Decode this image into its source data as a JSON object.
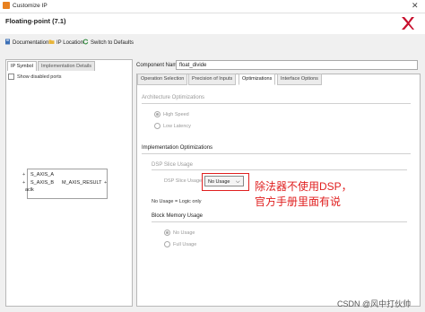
{
  "window": {
    "title": "Customize IP"
  },
  "header": {
    "title": "Floating-point (7.1)"
  },
  "toolbar": {
    "documentation": "Documentation",
    "ip_location": "IP Location",
    "switch_defaults": "Switch to Defaults"
  },
  "left_tabs": {
    "ip_symbol": "IP Symbol",
    "impl_details": "Implementation Details"
  },
  "left_panel": {
    "show_disabled": "Show disabled ports",
    "ports": {
      "s_axis_a": "S_AXIS_A",
      "s_axis_b": "S_AXIS_B",
      "aclk": "aclk",
      "m_axis_result": "M_AXIS_RESULT"
    }
  },
  "component": {
    "label": "Component Name",
    "value": "float_divide"
  },
  "right_tabs": [
    "Operation Selection",
    "Precision of Inputs",
    "Optimizations",
    "Interface Options"
  ],
  "arch": {
    "title": "Architecture Optimizations",
    "high_speed": "High Speed",
    "low_latency": "Low Latency"
  },
  "impl": {
    "title": "Implementation Optimizations",
    "dsp_title": "DSP Slice Usage",
    "dsp_label": "DSP Slice Usage",
    "dsp_value": "No Usage",
    "logic_only": "No Usage = Logic only",
    "bram_title": "Block Memory Usage",
    "bram_no_usage": "No Usage",
    "bram_full_usage": "Full Usage"
  },
  "annotation": {
    "text": "除法器不使用DSP，官方手册里面有说"
  },
  "watermark": "CSDN @风中打伙帅"
}
